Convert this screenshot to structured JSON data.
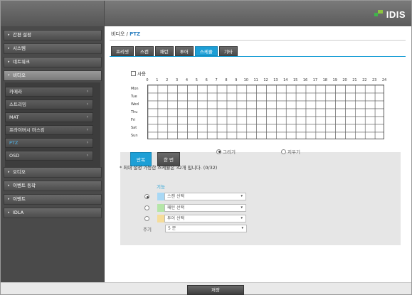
{
  "brand": {
    "logo_text": "IDIS"
  },
  "sidebar": {
    "items": [
      {
        "label": "간편 설정",
        "expanded": false
      },
      {
        "label": "시스템",
        "expanded": false
      },
      {
        "label": "네트워크",
        "expanded": false
      },
      {
        "label": "비디오",
        "expanded": true
      },
      {
        "label": "오디오",
        "expanded": false
      },
      {
        "label": "이벤트 동작",
        "expanded": false
      },
      {
        "label": "이벤트",
        "expanded": false
      },
      {
        "label": "IDLA",
        "expanded": false
      }
    ],
    "video_sub_items": [
      {
        "label": "카메라"
      },
      {
        "label": "스트리밍"
      },
      {
        "label": "MAT"
      },
      {
        "label": "프라이버시 마스킹"
      },
      {
        "label": "PTZ",
        "selected": true
      },
      {
        "label": "OSD"
      }
    ]
  },
  "breadcrumb": {
    "parent": "비디오",
    "separator": " / ",
    "current": "PTZ"
  },
  "tabs": [
    {
      "label": "프리셋"
    },
    {
      "label": "스캔"
    },
    {
      "label": "패턴"
    },
    {
      "label": "투어"
    },
    {
      "label": "스케쥴",
      "active": true
    },
    {
      "label": "기타"
    }
  ],
  "schedule": {
    "use_label": "사용",
    "use_checked": false,
    "hours": [
      "0",
      "1",
      "2",
      "3",
      "4",
      "5",
      "6",
      "7",
      "8",
      "9",
      "10",
      "11",
      "12",
      "13",
      "14",
      "15",
      "16",
      "17",
      "18",
      "19",
      "20",
      "21",
      "22",
      "23",
      "24"
    ],
    "days": [
      "Mon",
      "Tue",
      "Wed",
      "Thu",
      "Fri",
      "Sat",
      "Sun"
    ]
  },
  "mode_tabs": [
    {
      "label": "반복",
      "active": true
    },
    {
      "label": "한 번",
      "active": false
    }
  ],
  "function": {
    "label": "기능",
    "options": [
      {
        "selected": true,
        "swatch_color": "#a8d8f5",
        "value": "스캔 선택"
      },
      {
        "selected": false,
        "swatch_color": "#b5e6a8",
        "value": "패턴 선택"
      },
      {
        "selected": false,
        "swatch_color": "#f6dd9a",
        "value": "투어 선택"
      }
    ],
    "period_label": "주기",
    "period_value": "5 분"
  },
  "draw": {
    "draw_label": "그리기",
    "erase_label": "지우기",
    "draw_selected": true
  },
  "note": "* 최대 설정 가능한 스케쥴은 32개 입니다. (0/32)",
  "footer": {
    "save_label": "저장"
  },
  "colors": {
    "accent": "#1d9fd6",
    "sidebar_bg": "#4a4a4a"
  }
}
